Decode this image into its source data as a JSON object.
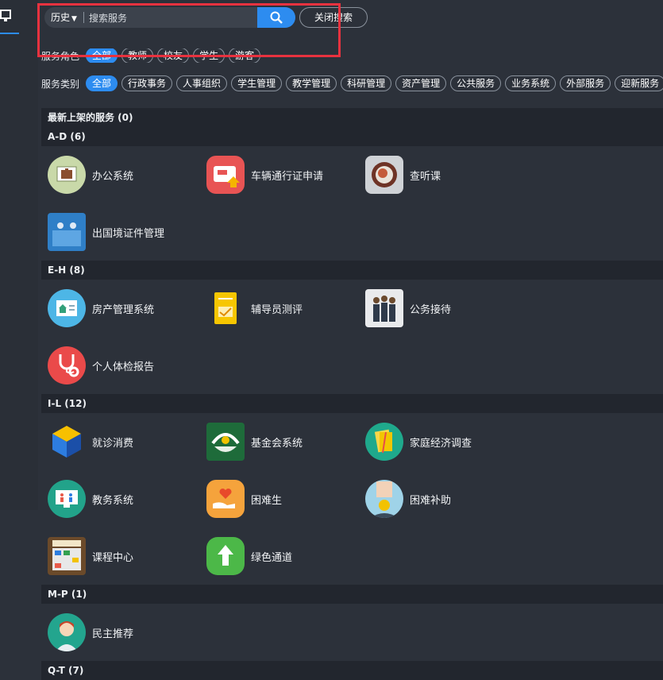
{
  "search": {
    "history_label": "历史",
    "placeholder": "搜索服务",
    "close_label": "关闭搜索"
  },
  "filters": {
    "row1": {
      "label": "服务角色",
      "chips": [
        "全部",
        "教师",
        "校友",
        "学生",
        "游客"
      ]
    },
    "row2": {
      "label": "服务类别",
      "chips": [
        "全部",
        "行政事务",
        "人事组织",
        "学生管理",
        "教学管理",
        "科研管理",
        "资产管理",
        "公共服务",
        "业务系统",
        "外部服务",
        "迎新服务"
      ]
    }
  },
  "sections": [
    {
      "title": "最新上架的服务 (0)",
      "items": []
    },
    {
      "title": "A-D (6)",
      "items": [
        {
          "label": "办公系统",
          "icon": "briefcase-icon"
        },
        {
          "label": "车辆通行证申请",
          "icon": "car-pass-icon"
        },
        {
          "label": "查听课",
          "icon": "classroom-icon"
        },
        {
          "label": "出国境证件管理",
          "icon": "passport-icon"
        }
      ]
    },
    {
      "title": "E-H (8)",
      "items": [
        {
          "label": "房产管理系统",
          "icon": "house-icon"
        },
        {
          "label": "辅导员测评",
          "icon": "evaluation-icon"
        },
        {
          "label": "公务接待",
          "icon": "reception-icon"
        },
        {
          "label": "个人体检报告",
          "icon": "stethoscope-icon"
        }
      ]
    },
    {
      "title": "I-L (12)",
      "items": [
        {
          "label": "就诊消费",
          "icon": "cube-icon"
        },
        {
          "label": "基金会系统",
          "icon": "foundation-icon"
        },
        {
          "label": "家庭经济调查",
          "icon": "survey-icon"
        },
        {
          "label": "教务系统",
          "icon": "academic-icon"
        },
        {
          "label": "困难生",
          "icon": "heart-hand-icon"
        },
        {
          "label": "困难补助",
          "icon": "coin-hand-icon"
        },
        {
          "label": "课程中心",
          "icon": "timetable-icon"
        },
        {
          "label": "绿色通道",
          "icon": "green-arrow-icon"
        }
      ]
    },
    {
      "title": "M-P (1)",
      "items": [
        {
          "label": "民主推荐",
          "icon": "person-icon"
        }
      ]
    },
    {
      "title": "Q-T (7)",
      "items": []
    }
  ],
  "colors": {
    "accent": "#2d8cf0",
    "highlight_box": "#e8323f",
    "background": "#2c313a"
  }
}
